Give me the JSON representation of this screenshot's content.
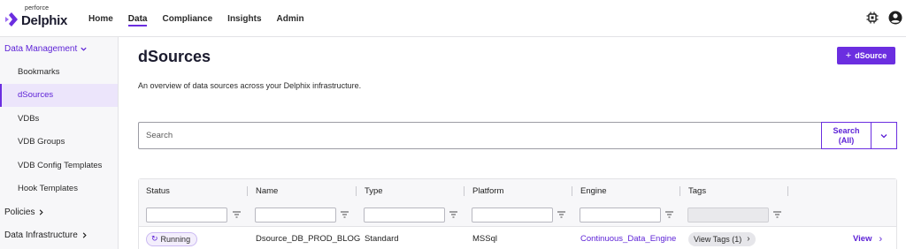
{
  "brand": {
    "small": "perforce",
    "name": "Delphix",
    "accent": "#6b2ee0"
  },
  "nav": {
    "items": [
      {
        "label": "Home"
      },
      {
        "label": "Data",
        "active": true
      },
      {
        "label": "Compliance"
      },
      {
        "label": "Insights"
      },
      {
        "label": "Admin"
      }
    ],
    "icons": [
      "chip-icon",
      "user-account-icon"
    ]
  },
  "sidebar": {
    "groups": [
      {
        "label": "Data Management",
        "expanded": true
      },
      {
        "label": "Policies",
        "expanded": false
      },
      {
        "label": "Data Infrastructure",
        "expanded": false
      }
    ],
    "items": [
      {
        "label": "Bookmarks"
      },
      {
        "label": "dSources",
        "active": true
      },
      {
        "label": "VDBs"
      },
      {
        "label": "VDB Groups"
      },
      {
        "label": "VDB Config Templates"
      },
      {
        "label": "Hook Templates"
      }
    ]
  },
  "page": {
    "title": "dSources",
    "add_button": "dSource",
    "subtitle": "An overview of data sources across your Delphix infrastructure."
  },
  "search": {
    "placeholder": "Search",
    "button_line1": "Search",
    "button_line2": "(All)"
  },
  "table": {
    "columns": [
      "Status",
      "Name",
      "Type",
      "Platform",
      "Engine",
      "Tags"
    ],
    "rows": [
      {
        "status": "Running",
        "name": "Dsource_DB_PROD_BLOG",
        "type": "Standard",
        "platform": "MSSql",
        "engine": "Continuous_Data_Engine",
        "tags": "View Tags (1)",
        "action": "View"
      }
    ]
  }
}
